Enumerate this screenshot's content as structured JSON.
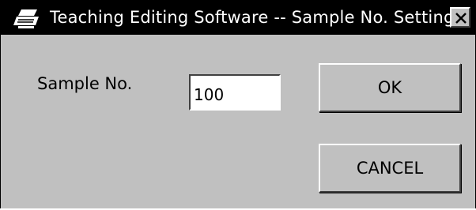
{
  "window": {
    "title": "Teaching Editing Software -- Sample No. Setting",
    "app_icon": "printer-icon",
    "close_icon": "close-icon"
  },
  "form": {
    "sample_label": "Sample No.",
    "sample_value": "100"
  },
  "buttons": {
    "ok_label": "OK",
    "cancel_label": "CANCEL"
  },
  "colors": {
    "titlebar": "#000000",
    "client": "#c0c0c0"
  }
}
